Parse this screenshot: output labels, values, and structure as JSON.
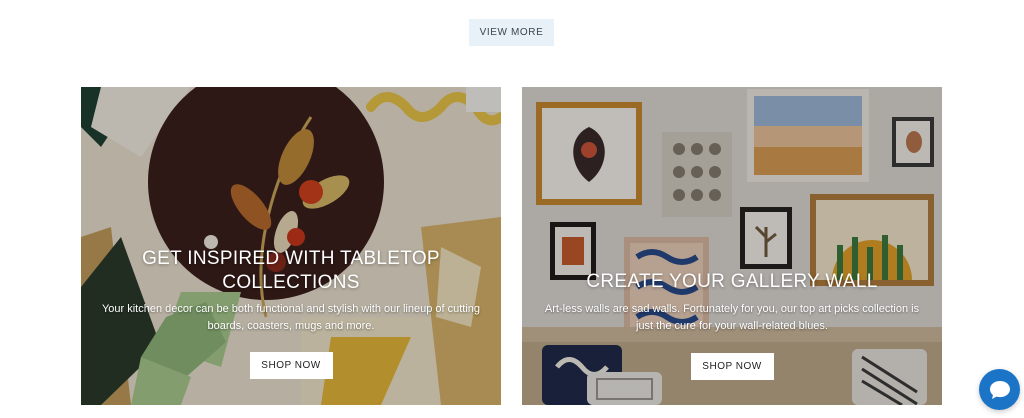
{
  "view_more": {
    "label": "VIEW MORE"
  },
  "cards": [
    {
      "title": "GET INSPIRED WITH TABLETOP COLLECTIONS",
      "description": "Your kitchen decor can be both functional and stylish with our lineup of cutting boards, coasters, mugs and more.",
      "button": "SHOP NOW"
    },
    {
      "title": "CREATE YOUR GALLERY WALL",
      "description": "Art-less walls are sad walls. Fortunately for you, our top art picks collection is just the cure for your wall-related blues.",
      "button": "SHOP NOW"
    }
  ],
  "chat": {
    "icon": "chat-bubble-icon",
    "color": "#1b74c6"
  }
}
